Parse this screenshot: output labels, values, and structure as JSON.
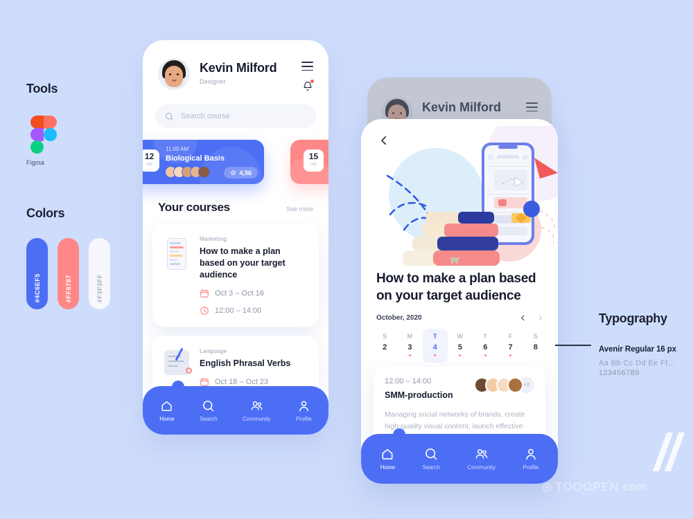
{
  "style_guide": {
    "tools_heading": "Tools",
    "tool_name": "Figma",
    "colors_heading": "Colors",
    "swatches": [
      {
        "hex": "#4C6EF5",
        "label": "#4C6EF5",
        "text_color": "#ffffff"
      },
      {
        "hex": "#FF8787",
        "label": "#FF8787",
        "text_color": "#ffffff"
      },
      {
        "hex": "#F3F3FF",
        "label": "#F3F3FF",
        "text_color": "#9aa0b2"
      }
    ],
    "typography_heading": "Typography",
    "font_spec": "Avenir Regular 16 px",
    "alphabet_sample": "Aa Bb Cc Dd Ee Ff…",
    "numeral_sample": "123456789"
  },
  "watermark": {
    "text": "TOOOPEN.com"
  },
  "phone_home": {
    "profile": {
      "name": "Kevin Milford",
      "role": "Designer"
    },
    "header_icons": {
      "menu": "hamburger-menu-icon",
      "notifications": "bell-icon"
    },
    "search": {
      "placeholder": "Search course"
    },
    "featured_card": {
      "time": "11:00 AM",
      "title": "Biological Basis",
      "day": "12",
      "month": "oct",
      "rating": "4,56",
      "attendee_count": 5
    },
    "secondary_card": {
      "day": "15",
      "month": "oct"
    },
    "section": {
      "title": "Your courses",
      "see_more": "See more"
    },
    "courses": [
      {
        "category": "Marketing",
        "title": "How to make a plan based on your target audience",
        "dates": "Oct 3 – Oct 16",
        "time": "12:00 – 14:00"
      },
      {
        "category": "Language",
        "title": "English Phrasal Verbs",
        "dates": "Oct 18 – Oct 23"
      }
    ],
    "nav": [
      {
        "label": "Home",
        "icon": "home-icon",
        "active": true
      },
      {
        "label": "Search",
        "icon": "search-icon",
        "active": false
      },
      {
        "label": "Community",
        "icon": "community-icon",
        "active": false
      },
      {
        "label": "Profile",
        "icon": "profile-icon",
        "active": false
      }
    ]
  },
  "phone_detail": {
    "background_header": {
      "name": "Kevin Milford"
    },
    "back_icon": "chevron-left-icon",
    "title": "How to make a plan based on your target audience",
    "calendar": {
      "month_label": "October, 2020",
      "prev_icon": "chevron-left-icon",
      "next_icon": "chevron-right-icon",
      "days": [
        {
          "dow": "S",
          "num": "2",
          "dot": false,
          "selected": false
        },
        {
          "dow": "M",
          "num": "3",
          "dot": true,
          "selected": false
        },
        {
          "dow": "T",
          "num": "4",
          "dot": true,
          "selected": true
        },
        {
          "dow": "W",
          "num": "5",
          "dot": true,
          "selected": false
        },
        {
          "dow": "T",
          "num": "6",
          "dot": true,
          "selected": false
        },
        {
          "dow": "F",
          "num": "7",
          "dot": true,
          "selected": false
        },
        {
          "dow": "S",
          "num": "8",
          "dot": false,
          "selected": false
        }
      ]
    },
    "event": {
      "time": "12:00 – 14:00",
      "name": "SMM-production",
      "extra_count": "+3",
      "description": "Managing social networks of brands, create high-quality visual content, launch effective advertising campaigns and interactions with"
    },
    "nav": [
      {
        "label": "Home",
        "icon": "home-icon",
        "active": true
      },
      {
        "label": "Search",
        "icon": "search-icon",
        "active": false
      },
      {
        "label": "Community",
        "icon": "community-icon",
        "active": false
      },
      {
        "label": "Profile",
        "icon": "profile-icon",
        "active": false
      }
    ]
  }
}
